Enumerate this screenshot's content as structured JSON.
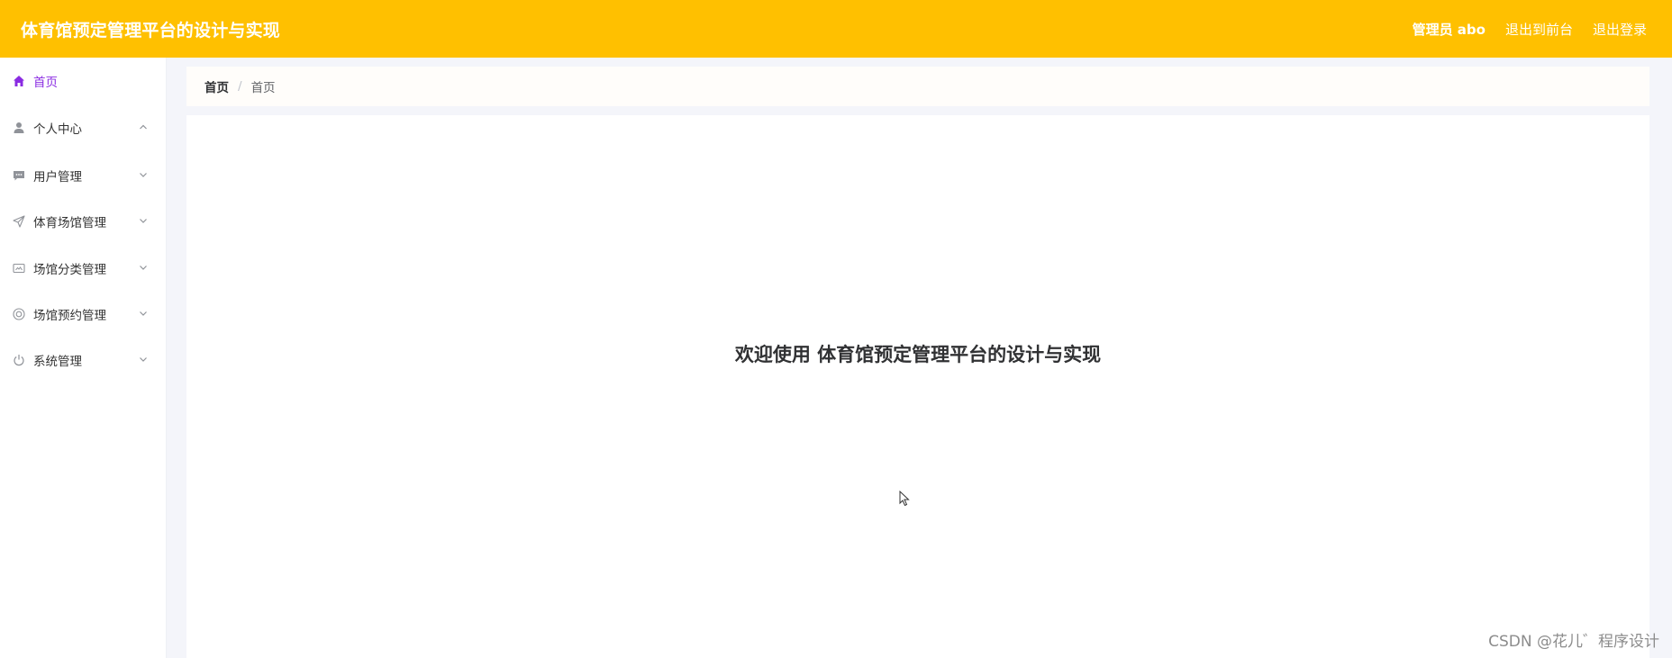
{
  "header": {
    "title": "体育馆预定管理平台的设计与实现",
    "admin_label": "管理员 abo",
    "to_front_label": "退出到前台",
    "logout_label": "退出登录"
  },
  "sidebar": {
    "items": [
      {
        "label": "首页",
        "icon": "home-icon",
        "active": true
      },
      {
        "label": "个人中心",
        "icon": "user-icon",
        "expanded": true
      },
      {
        "label": "用户管理",
        "icon": "chat-icon"
      },
      {
        "label": "体育场馆管理",
        "icon": "send-icon"
      },
      {
        "label": "场馆分类管理",
        "icon": "card-icon"
      },
      {
        "label": "场馆预约管理",
        "icon": "lifebuoy-icon"
      },
      {
        "label": "系统管理",
        "icon": "power-icon"
      }
    ]
  },
  "breadcrumb": {
    "home": "首页",
    "separator": "/",
    "current": "首页"
  },
  "main": {
    "welcome_text": "欢迎使用 体育馆预定管理平台的设计与实现"
  },
  "watermark": "CSDN @花儿゛程序设计",
  "colors": {
    "header_bg": "#ffc000",
    "active_menu": "#8a2be2"
  }
}
